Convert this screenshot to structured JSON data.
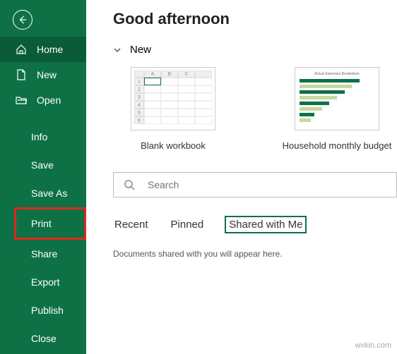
{
  "sidebar": {
    "items": [
      {
        "label": "Home",
        "icon": "home-icon"
      },
      {
        "label": "New",
        "icon": "new-doc-icon"
      },
      {
        "label": "Open",
        "icon": "folder-icon"
      }
    ],
    "sub_items": [
      {
        "label": "Info"
      },
      {
        "label": "Save"
      },
      {
        "label": "Save As"
      },
      {
        "label": "Print"
      },
      {
        "label": "Share"
      },
      {
        "label": "Export"
      },
      {
        "label": "Publish"
      },
      {
        "label": "Close"
      }
    ]
  },
  "main": {
    "greeting": "Good afternoon",
    "new_section": "New",
    "templates": [
      {
        "label": "Blank workbook"
      },
      {
        "label": "Household monthly budget"
      }
    ],
    "search_placeholder": "Search",
    "tabs": [
      {
        "label": "Recent"
      },
      {
        "label": "Pinned"
      },
      {
        "label": "Shared with Me"
      }
    ],
    "empty_message": "Documents shared with you will appear here."
  },
  "watermark": "wxkin.com"
}
